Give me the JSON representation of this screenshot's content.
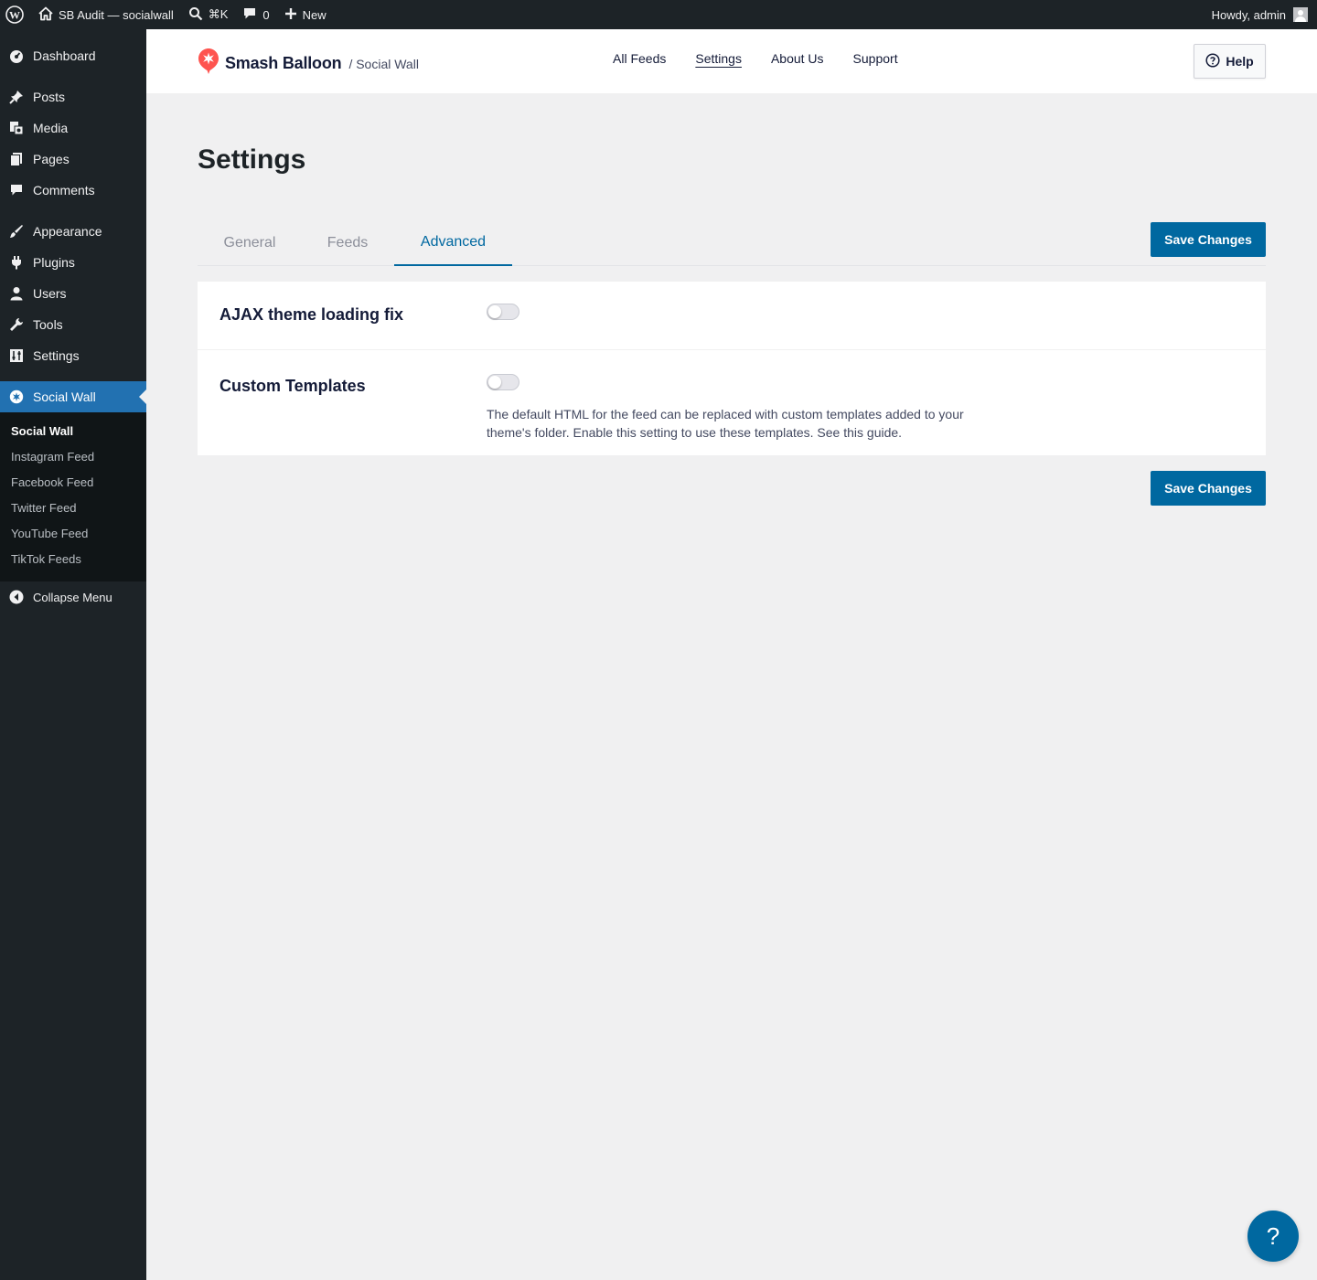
{
  "adminbar": {
    "site_name": "SB Audit — socialwall",
    "search_shortcut": "⌘K",
    "comments_count": "0",
    "new_label": "New",
    "greeting": "Howdy, admin"
  },
  "sidebar": {
    "items": [
      {
        "label": "Dashboard",
        "icon": "dashboard-icon"
      },
      {
        "label": "Posts",
        "icon": "pushpin-icon"
      },
      {
        "label": "Media",
        "icon": "media-icon"
      },
      {
        "label": "Pages",
        "icon": "pages-icon"
      },
      {
        "label": "Comments",
        "icon": "comment-icon"
      },
      {
        "label": "Appearance",
        "icon": "brush-icon"
      },
      {
        "label": "Plugins",
        "icon": "plug-icon"
      },
      {
        "label": "Users",
        "icon": "user-icon"
      },
      {
        "label": "Tools",
        "icon": "wrench-icon"
      },
      {
        "label": "Settings",
        "icon": "settings-icon"
      },
      {
        "label": "Social Wall",
        "icon": "smash-balloon-icon"
      }
    ],
    "submenu": [
      "Social Wall",
      "Instagram Feed",
      "Facebook Feed",
      "Twitter Feed",
      "YouTube Feed",
      "TikTok Feeds"
    ],
    "collapse_label": "Collapse Menu"
  },
  "header": {
    "brand_name": "Smash Balloon",
    "brand_sub": "/ Social Wall",
    "nav": [
      "All Feeds",
      "Settings",
      "About Us",
      "Support"
    ],
    "help_label": "Help"
  },
  "main": {
    "title": "Settings",
    "tabs": [
      "General",
      "Feeds",
      "Advanced"
    ],
    "active_tab": "Advanced",
    "save_label": "Save Changes",
    "settings": [
      {
        "label": "AJAX theme loading fix",
        "enabled": false
      },
      {
        "label": "Custom Templates",
        "enabled": false,
        "description": "The default HTML for the feed can be replaced with custom templates added to your theme's folder. Enable this setting to use these templates. See this guide."
      }
    ]
  },
  "colors": {
    "accent": "#0068a0",
    "admin_dark": "#1d2327",
    "current_menu": "#2271b1",
    "brand_red": "#fe544f"
  }
}
